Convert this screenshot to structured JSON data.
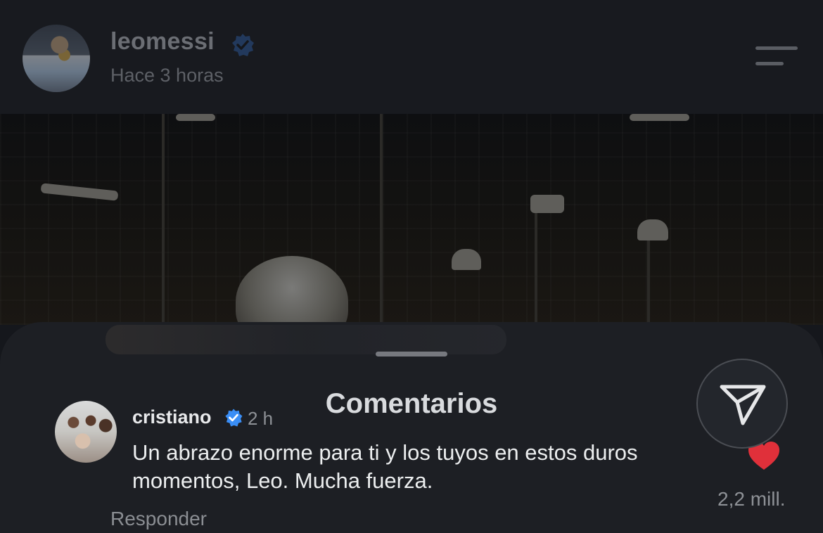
{
  "post": {
    "username": "leomessi",
    "time": "Hace 3 horas"
  },
  "sheet": {
    "title": "Comentarios"
  },
  "comment": {
    "username": "cristiano",
    "time": "2 h",
    "text": "Un abrazo enorme para ti y los tuyos en estos duros momentos, Leo. Mucha fuerza.",
    "reply_label": "Responder",
    "likes": "2,2 mill."
  },
  "colors": {
    "verified": "#3a8ef6",
    "heart": "#e0303a"
  }
}
